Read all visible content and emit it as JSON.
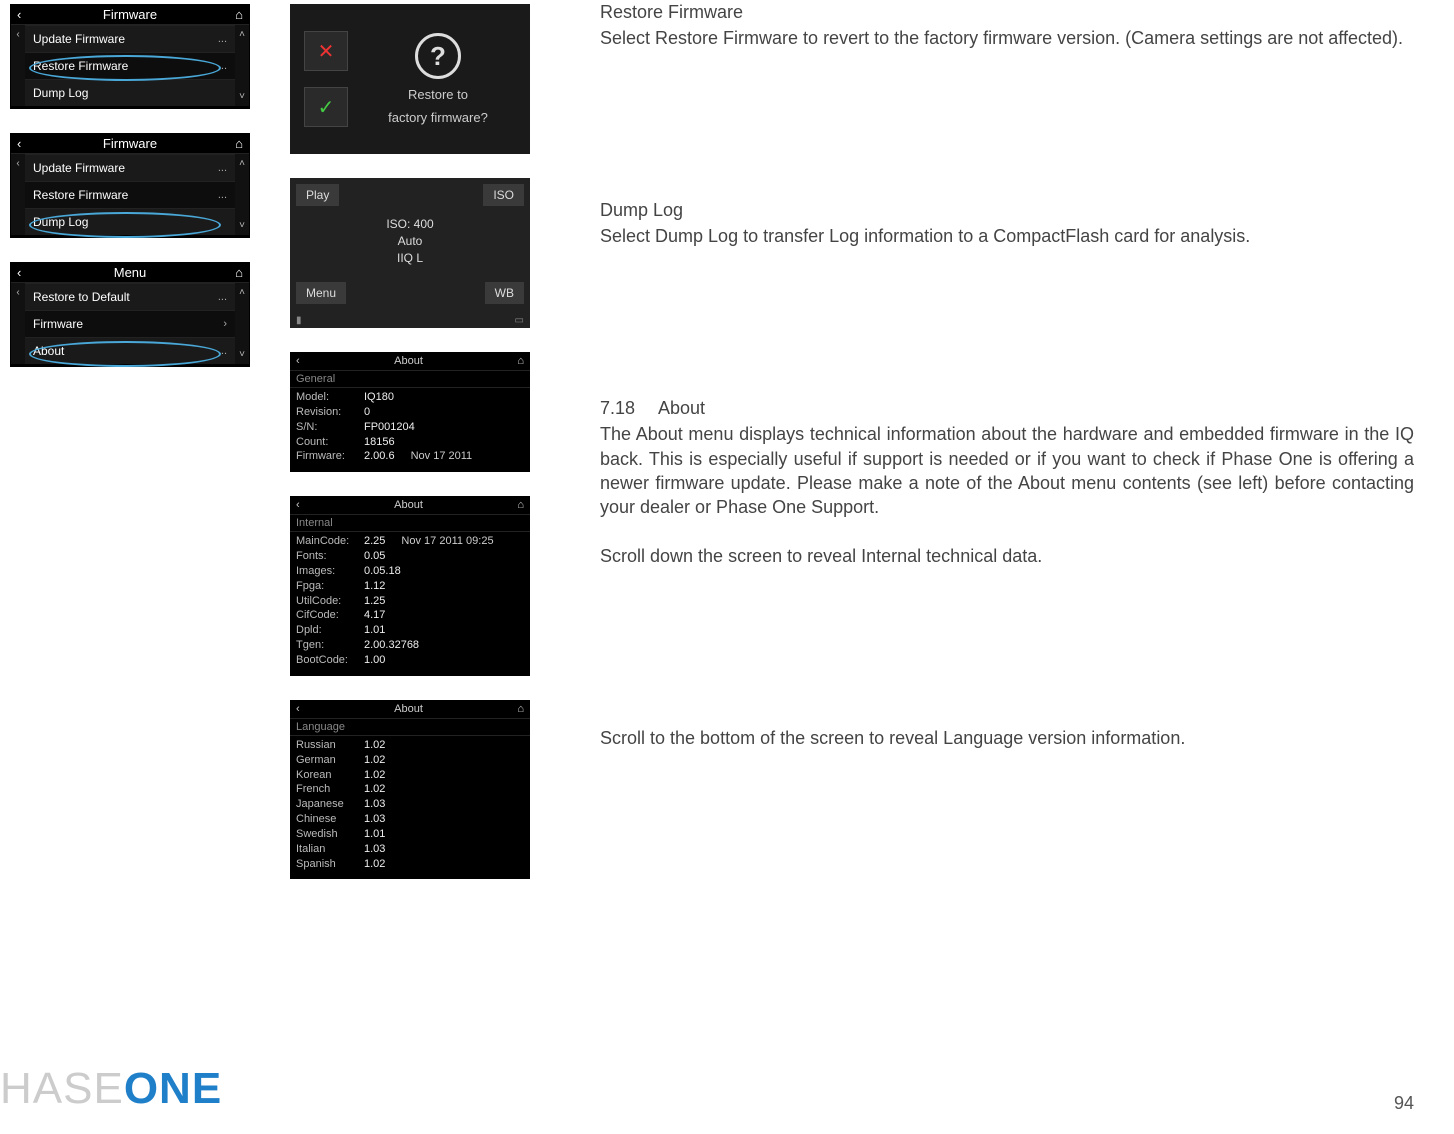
{
  "screens": {
    "firmware1": {
      "title": "Firmware",
      "items": [
        {
          "label": "Update Firmware",
          "rhs": "..."
        },
        {
          "label": "Restore Firmware",
          "rhs": "..."
        },
        {
          "label": "Dump Log",
          "rhs": ""
        }
      ]
    },
    "firmware2": {
      "title": "Firmware",
      "items": [
        {
          "label": "Update Firmware",
          "rhs": "..."
        },
        {
          "label": "Restore Firmware",
          "rhs": "..."
        },
        {
          "label": "Dump Log",
          "rhs": ""
        }
      ]
    },
    "menu": {
      "title": "Menu",
      "items": [
        {
          "label": "Restore to Default",
          "rhs": "..."
        },
        {
          "label": "Firmware",
          "rhs": "›"
        },
        {
          "label": "About",
          "rhs": "..."
        }
      ]
    },
    "dialog": {
      "line1": "Restore to",
      "line2": "factory firmware?"
    },
    "quick": {
      "tl": "Play",
      "tr": "ISO",
      "bl": "Menu",
      "br": "WB",
      "c1": "ISO: 400",
      "c2": "Auto",
      "c3": "IIQ L"
    },
    "about_general": {
      "title": "About",
      "section": "General",
      "rows": [
        {
          "k": "Model:",
          "v": "IQ180"
        },
        {
          "k": "Revision:",
          "v": "0"
        },
        {
          "k": "S/N:",
          "v": "FP001204"
        },
        {
          "k": "Count:",
          "v": "18156"
        },
        {
          "k": "Firmware:",
          "v": "2.00.6",
          "extra": "Nov 17 2011"
        }
      ]
    },
    "about_internal": {
      "title": "About",
      "section": "Internal",
      "rows": [
        {
          "k": "MainCode:",
          "v": "2.25",
          "extra": "Nov 17 2011 09:25"
        },
        {
          "k": "Fonts:",
          "v": "0.05"
        },
        {
          "k": "Images:",
          "v": "0.05.18"
        },
        {
          "k": "Fpga:",
          "v": "1.12"
        },
        {
          "k": "UtilCode:",
          "v": "1.25"
        },
        {
          "k": "CifCode:",
          "v": "4.17"
        },
        {
          "k": "Dpld:",
          "v": "1.01"
        },
        {
          "k": "Tgen:",
          "v": "2.00.32768"
        },
        {
          "k": "BootCode:",
          "v": "1.00"
        }
      ]
    },
    "about_lang": {
      "title": "About",
      "section": "Language",
      "rows": [
        {
          "k": "Russian",
          "v": "1.02"
        },
        {
          "k": "German",
          "v": "1.02"
        },
        {
          "k": "Korean",
          "v": "1.02"
        },
        {
          "k": "French",
          "v": "1.02"
        },
        {
          "k": "Japanese",
          "v": "1.03"
        },
        {
          "k": "Chinese",
          "v": "1.03"
        },
        {
          "k": "Swedish",
          "v": "1.01"
        },
        {
          "k": "Italian",
          "v": "1.03"
        },
        {
          "k": "Spanish",
          "v": "1.02"
        }
      ]
    }
  },
  "text": {
    "restore_h": "Restore Firmware",
    "restore_b": "Select Restore Firmware to revert to the factory firmware version. (Camera settings are not affected).",
    "dump_h": "Dump Log",
    "dump_b": "Select Dump Log to transfer Log information to a CompactFlash card for analysis.",
    "about_num": "7.18",
    "about_h": "About",
    "about_b": "The About menu displays technical information about the hardware and embedded firmware in the IQ back. This is especially useful if support is needed or if you want to check if Phase One is offering a newer firmware update. Please make a note of the About menu contents (see left) before contacting your dealer or Phase One Support.",
    "about_b2": "Scroll down the screen to reveal Internal technical data.",
    "lang_b": "Scroll to the bottom of the screen to reveal Language version information."
  },
  "footer": {
    "logo_gray": "HASE",
    "logo_blue": "ONE",
    "page": "94"
  },
  "glyphs": {
    "back": "‹",
    "home": "⌂",
    "up": "˄",
    "down": "˅",
    "q": "?"
  }
}
